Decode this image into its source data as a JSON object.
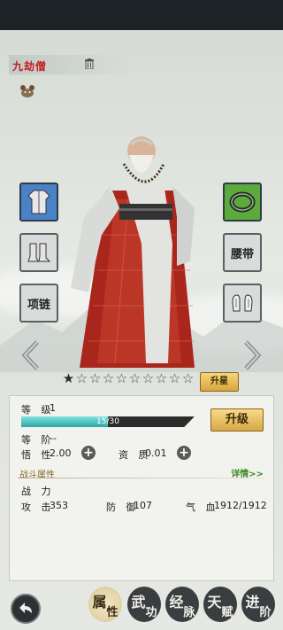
{
  "character": {
    "name": "九劫僧"
  },
  "equipment": {
    "left": [
      {
        "name": "armor-slot",
        "icon": "robe-icon"
      },
      {
        "name": "boots-slot",
        "icon": "boots-icon"
      },
      {
        "name": "necklace-slot",
        "label": "项链"
      }
    ],
    "right": [
      {
        "name": "ring-slot",
        "icon": "ring-icon"
      },
      {
        "name": "belt-slot",
        "label": "腰带"
      },
      {
        "name": "gloves-slot",
        "icon": "gloves-icon"
      }
    ]
  },
  "stars": {
    "filled": 1,
    "total": 10
  },
  "upgrade_star_label": "升星",
  "stats": {
    "level_label": "等 级",
    "level_value": "1",
    "xp_text": "15/30",
    "xp_fraction": 0.5,
    "upgrade_label": "升级",
    "rank_label": "等 阶",
    "rank_value": "--",
    "insight_label": "悟 性",
    "insight_value": "2.00",
    "aptitude_label": "资 质",
    "aptitude_value": "0.01",
    "battle_section": "战斗属性",
    "detail_link": "详情>>",
    "power_label": "战 力",
    "attack_label": "攻 击",
    "attack_value": "353",
    "defense_label": "防 御",
    "defense_value": "107",
    "hp_label": "气 血",
    "hp_value": "1912/1912"
  },
  "nav": {
    "tabs": [
      {
        "label_a": "属",
        "label_b": "性",
        "active": true
      },
      {
        "label_a": "武",
        "label_b": "功",
        "active": false
      },
      {
        "label_a": "经",
        "label_b": "脉",
        "active": false
      },
      {
        "label_a": "天",
        "label_b": "赋",
        "active": false
      },
      {
        "label_a": "进",
        "label_b": "阶",
        "active": false
      }
    ]
  },
  "colors": {
    "name_red": "#c21d1d",
    "detail_green": "#3a8a22",
    "xp_fill": "#2fa7a6",
    "gold_button": "#e6b957"
  }
}
